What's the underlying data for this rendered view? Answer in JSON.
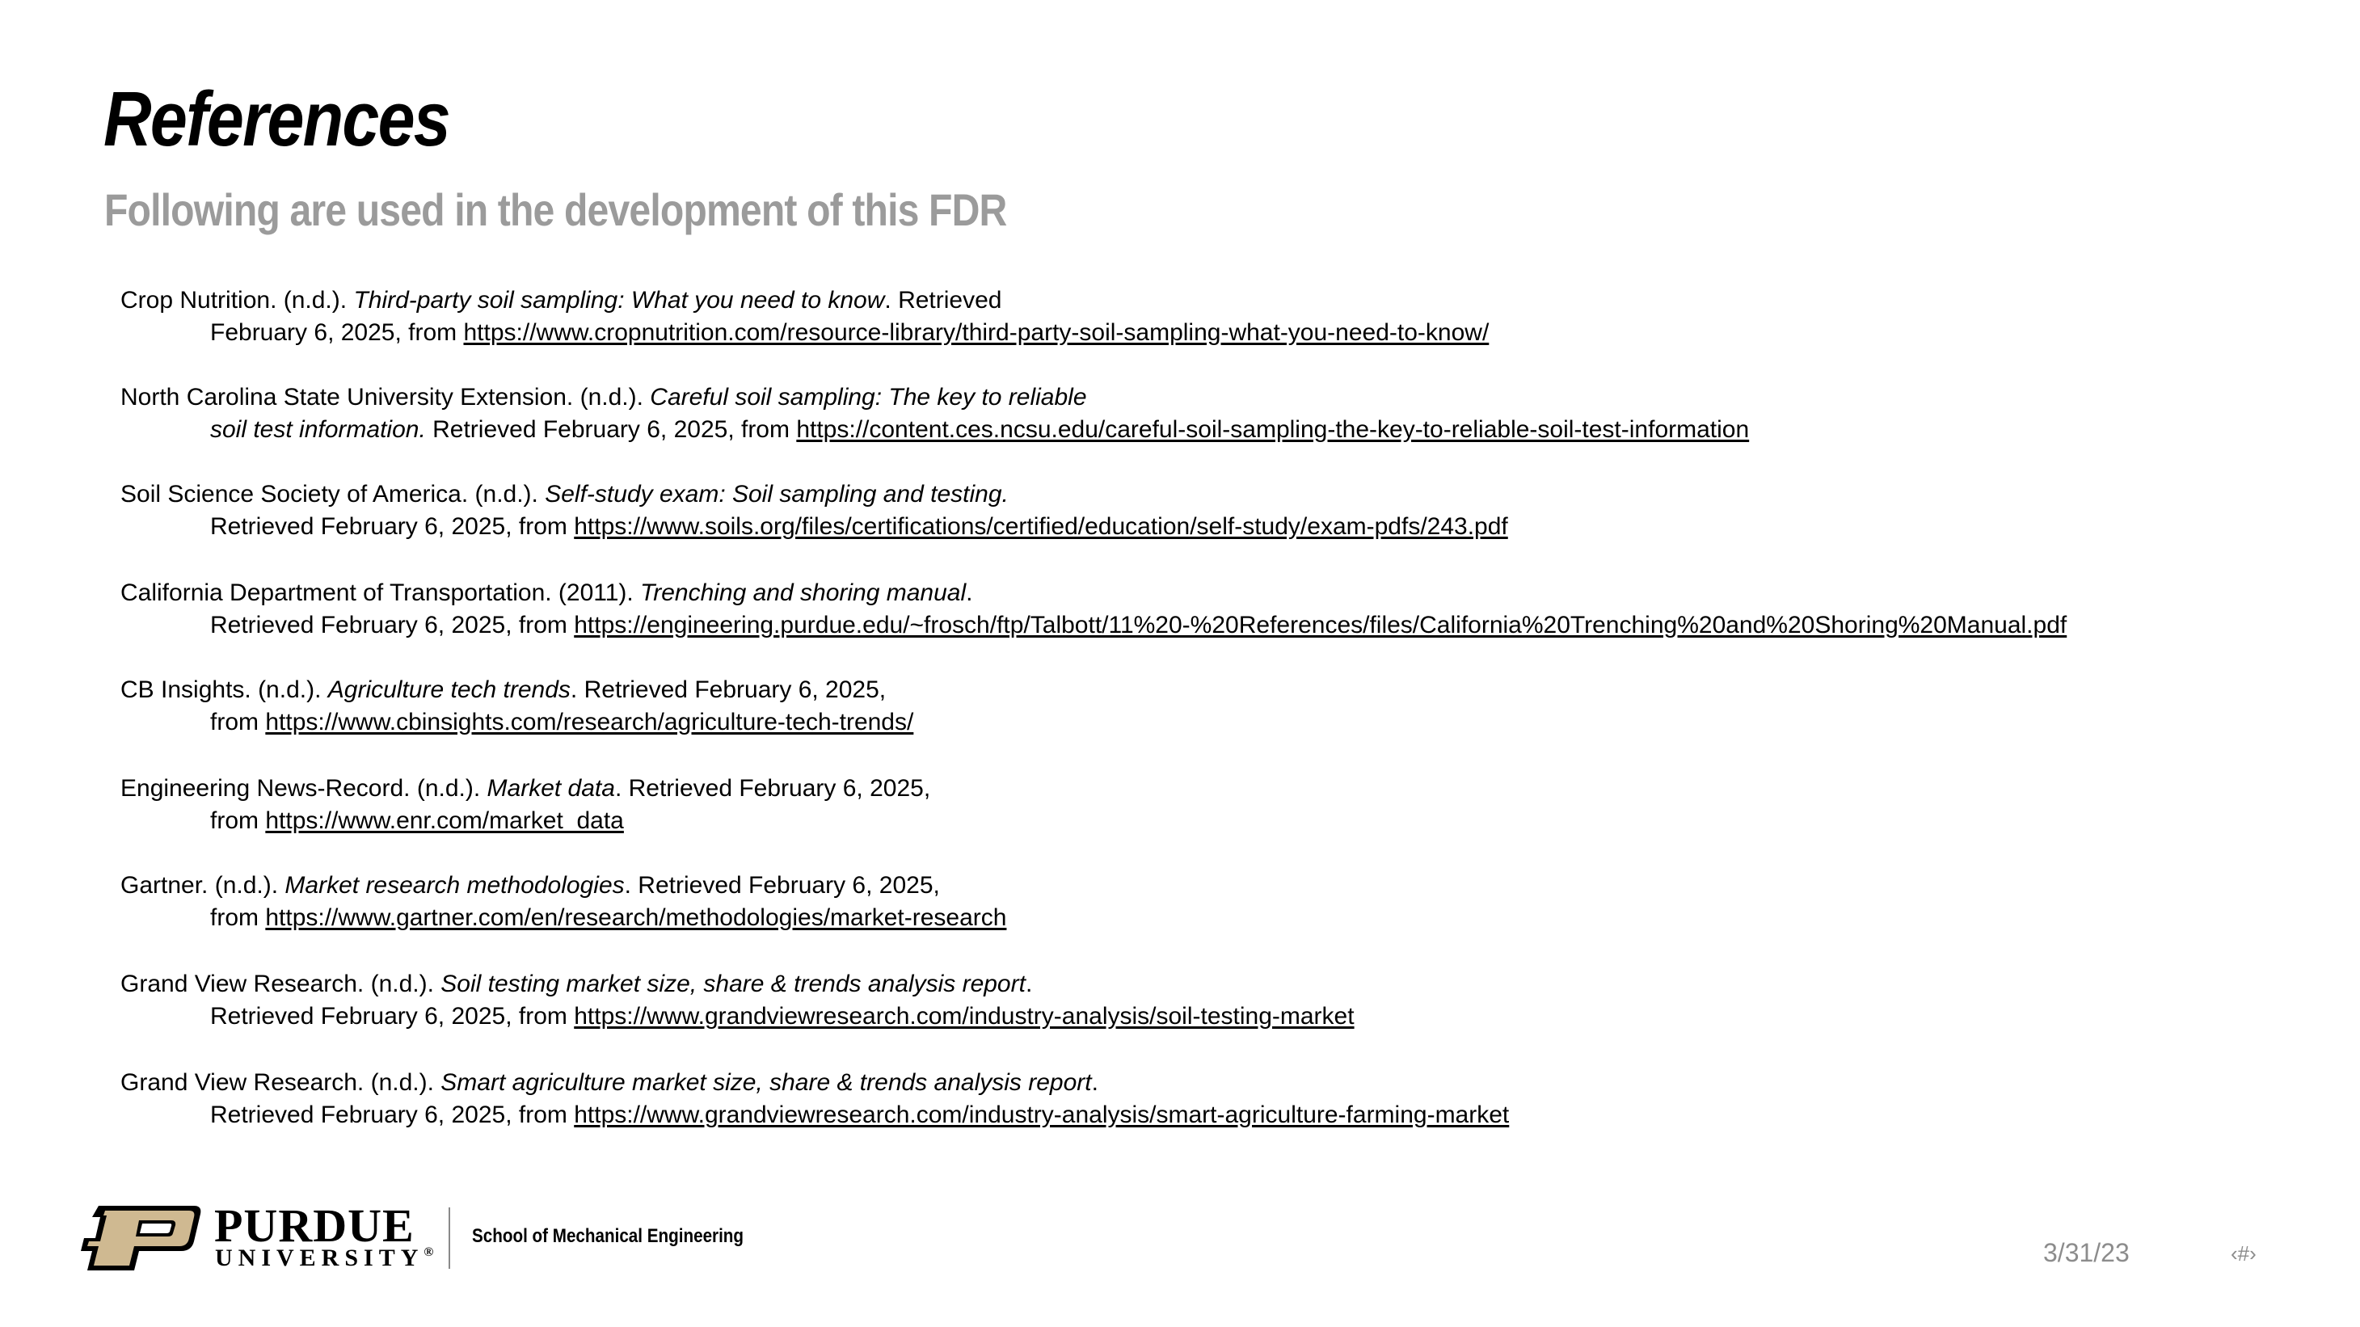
{
  "slide": {
    "title": "References",
    "subtitle": "Following are used in the development of this FDR",
    "date": "3/31/23",
    "slide_number": "‹#›"
  },
  "references": [
    {
      "author": "Crop Nutrition. (n.d.). ",
      "title_italic": "Third-party soil sampling: What you need to know",
      "after_title": ". Retrieved",
      "line2_prefix": "February 6, 2025, from ",
      "line2_italic": "",
      "url": "https://www.cropnutrition.com/resource-library/third-party-soil-sampling-what-you-need-to-know/"
    },
    {
      "author": "North Carolina State University Extension. (n.d.). ",
      "title_italic": "Careful soil sampling: The key to reliable",
      "after_title": "",
      "line2_italic": "soil test information.",
      "line2_prefix": " Retrieved February 6, 2025, from ",
      "url": "https://content.ces.ncsu.edu/careful-soil-sampling-the-key-to-reliable-soil-test-information"
    },
    {
      "author": "Soil Science Society of America. (n.d.). ",
      "title_italic": "Self-study exam: Soil sampling and testing.",
      "after_title": "",
      "line2_prefix": "Retrieved February 6, 2025, from ",
      "line2_italic": "",
      "url": "https://www.soils.org/files/certifications/certified/education/self-study/exam-pdfs/243.pdf"
    },
    {
      "author": "California Department of Transportation. (2011). ",
      "title_italic": "Trenching and shoring manual",
      "after_title": ".",
      "line2_prefix": "Retrieved February 6, 2025, from ",
      "line2_italic": "",
      "url": "https://engineering.purdue.edu/~frosch/ftp/Talbott/11%20-%20References/files/California%20Trenching%20and%20Shoring%20Manual.pdf"
    },
    {
      "author": "CB Insights. (n.d.). ",
      "title_italic": "Agriculture tech trends",
      "after_title": ". Retrieved February 6, 2025,",
      "line2_prefix": "from ",
      "line2_italic": "",
      "url": "https://www.cbinsights.com/research/agriculture-tech-trends/"
    },
    {
      "author": "Engineering News-Record. (n.d.). ",
      "title_italic": "Market data",
      "after_title": ". Retrieved February 6, 2025,",
      "line2_prefix": "from ",
      "line2_italic": "",
      "url": "https://www.enr.com/market_data"
    },
    {
      "author": "Gartner. (n.d.). ",
      "title_italic": "Market research methodologies",
      "after_title": ". Retrieved February 6, 2025,",
      "line2_prefix": "from ",
      "line2_italic": "",
      "url": "https://www.gartner.com/en/research/methodologies/market-research"
    },
    {
      "author": "Grand View Research. (n.d.). ",
      "title_italic": "Soil testing market size, share & trends analysis report",
      "after_title": ".",
      "line2_prefix": "Retrieved February 6, 2025, from ",
      "line2_italic": "",
      "url": "https://www.grandviewresearch.com/industry-analysis/soil-testing-market"
    },
    {
      "author": "Grand View Research. (n.d.). ",
      "title_italic": "Smart agriculture market size, share & trends analysis report",
      "after_title": ".",
      "line2_prefix": "Retrieved February 6, 2025, from ",
      "line2_italic": "",
      "url": "https://www.grandviewresearch.com/industry-analysis/smart-agriculture-farming-market"
    }
  ],
  "footer": {
    "logo_word": "PURDUE",
    "logo_subword": "UNIVERSITY",
    "logo_mark": "®",
    "department": "School of Mechanical Engineering",
    "icon": "purdue-p-logo-icon",
    "colors": {
      "gold": "#CFB991",
      "black": "#000000"
    }
  }
}
